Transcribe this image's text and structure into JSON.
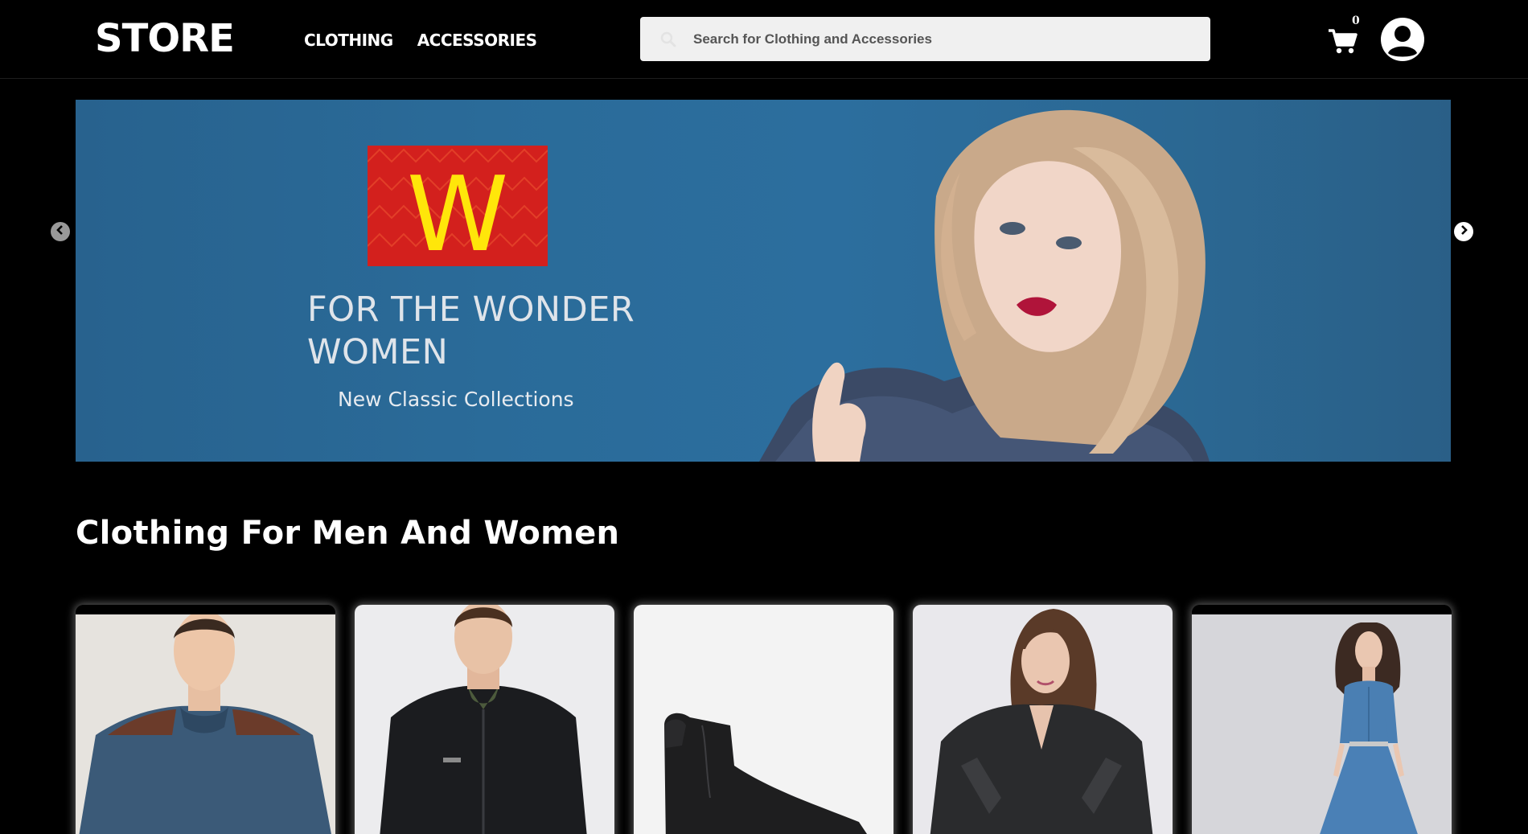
{
  "header": {
    "logo": "STORE",
    "nav": [
      {
        "label": "CLOTHING"
      },
      {
        "label": "ACCESSORIES"
      }
    ],
    "search": {
      "placeholder": "Search for Clothing and Accessories",
      "value": ""
    },
    "cart_count": "0"
  },
  "banner": {
    "logo_letter": "W",
    "title_line1": "FOR THE WONDER",
    "title_line2": "WOMEN",
    "subtitle": "New Classic Collections",
    "colors": {
      "logo_red": "#d3201d",
      "logo_yellow": "#ffe60a",
      "background": "#2b6894"
    }
  },
  "section": {
    "title": "Clothing For Men And Women"
  },
  "products": [
    {
      "icon": "sweater-model-image"
    },
    {
      "icon": "jacket-model-image"
    },
    {
      "icon": "boot-image"
    },
    {
      "icon": "leather-jacket-model-image"
    },
    {
      "icon": "denim-dress-model-image"
    }
  ]
}
